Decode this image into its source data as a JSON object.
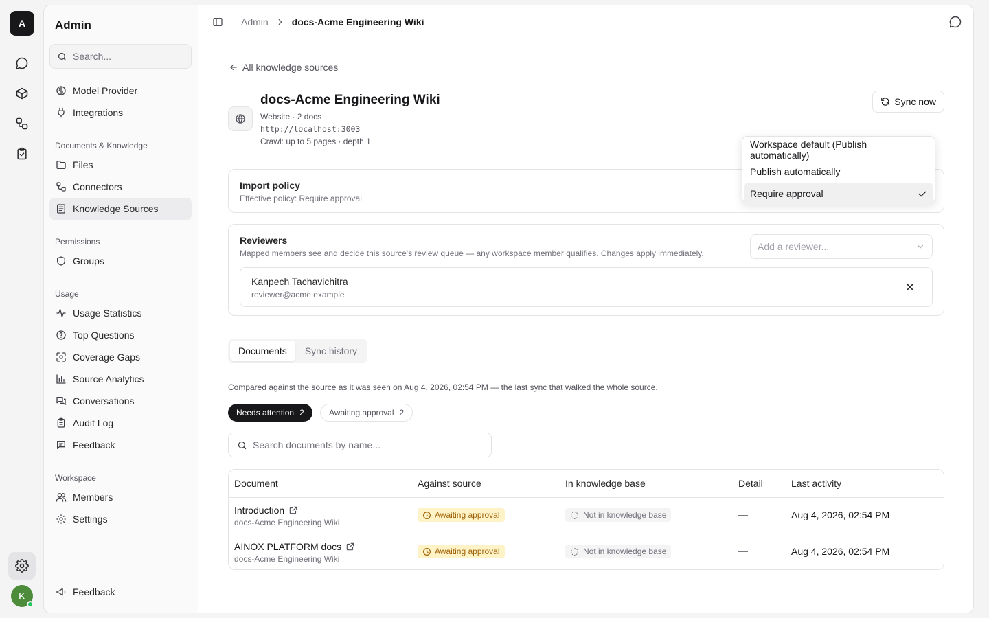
{
  "rail": {
    "logo": "A",
    "avatar": "K"
  },
  "sidebar": {
    "title": "Admin",
    "search_placeholder": "Search...",
    "top_items": [
      {
        "label": "Model Provider",
        "icon": "brain-icon"
      },
      {
        "label": "Integrations",
        "icon": "plug-icon"
      }
    ],
    "sections": [
      {
        "title": "Documents & Knowledge",
        "items": [
          {
            "label": "Files",
            "icon": "folder-icon"
          },
          {
            "label": "Connectors",
            "icon": "connectors-icon"
          },
          {
            "label": "Knowledge Sources",
            "icon": "book-icon",
            "active": true
          }
        ]
      },
      {
        "title": "Permissions",
        "items": [
          {
            "label": "Groups",
            "icon": "shield-icon"
          }
        ]
      },
      {
        "title": "Usage",
        "items": [
          {
            "label": "Usage Statistics",
            "icon": "activity-icon"
          },
          {
            "label": "Top Questions",
            "icon": "question-icon"
          },
          {
            "label": "Coverage Gaps",
            "icon": "scan-icon"
          },
          {
            "label": "Source Analytics",
            "icon": "bar-chart-icon"
          },
          {
            "label": "Conversations",
            "icon": "messages-icon"
          },
          {
            "label": "Audit Log",
            "icon": "clipboard-icon"
          },
          {
            "label": "Feedback",
            "icon": "message-square-icon"
          }
        ]
      },
      {
        "title": "Workspace",
        "items": [
          {
            "label": "Members",
            "icon": "users-icon"
          },
          {
            "label": "Settings",
            "icon": "gear-icon"
          }
        ]
      }
    ],
    "footer_feedback": "Feedback"
  },
  "topbar": {
    "crumb_root": "Admin",
    "crumb_current": "docs-Acme Engineering Wiki"
  },
  "page": {
    "back_label": "All knowledge sources",
    "title": "docs-Acme Engineering Wiki",
    "meta_type": "Website · 2 docs",
    "meta_url": "http://localhost:3003",
    "meta_crawl": "Crawl: up to 5 pages · depth 1",
    "sync_label": "Sync now"
  },
  "import_policy": {
    "title": "Import policy",
    "subtitle": "Effective policy: Require approval",
    "options": [
      {
        "label": "Workspace default (Publish automatically)",
        "selected": false
      },
      {
        "label": "Publish automatically",
        "selected": false
      },
      {
        "label": "Require approval",
        "selected": true
      }
    ]
  },
  "reviewers": {
    "title": "Reviewers",
    "subtitle": "Mapped members see and decide this source's review queue — any workspace member qualifies. Changes apply immediately.",
    "add_placeholder": "Add a reviewer...",
    "people": [
      {
        "name": "Kanpech Tachavichitra",
        "email": "reviewer@acme.example"
      }
    ]
  },
  "tabs": [
    {
      "label": "Documents",
      "active": true
    },
    {
      "label": "Sync history",
      "active": false
    }
  ],
  "compared_note": "Compared against the source as it was seen on Aug 4, 2026, 02:54 PM — the last sync that walked the whole source.",
  "filters": [
    {
      "label": "Needs attention",
      "count": "2"
    },
    {
      "label": "Awaiting approval",
      "count": "2"
    }
  ],
  "doc_search_placeholder": "Search documents by name...",
  "table": {
    "headers": [
      "Document",
      "Against source",
      "In knowledge base",
      "Detail",
      "Last activity"
    ],
    "rows": [
      {
        "name": "Introduction",
        "source": "docs-Acme Engineering Wiki",
        "against": "Awaiting approval",
        "kb": "Not in knowledge base",
        "detail": "—",
        "last": "Aug 4, 2026, 02:54 PM"
      },
      {
        "name": "AINOX PLATFORM docs",
        "source": "docs-Acme Engineering Wiki",
        "against": "Awaiting approval",
        "kb": "Not in knowledge base",
        "detail": "—",
        "last": "Aug 4, 2026, 02:54 PM"
      }
    ]
  },
  "colors": {
    "accent_dark": "#18181b",
    "awaiting_bg": "#fdf3c7",
    "awaiting_fg": "#a1620a",
    "avatar": "#4d8c3a"
  }
}
